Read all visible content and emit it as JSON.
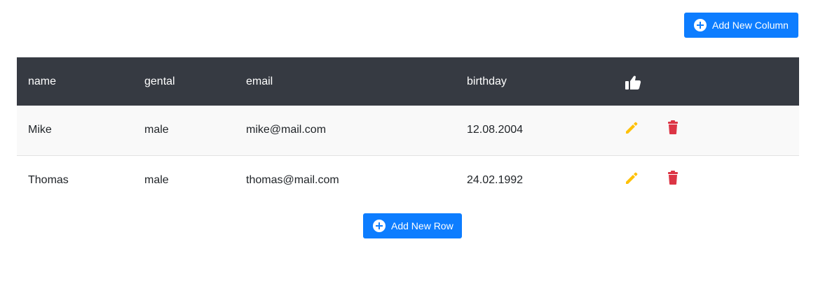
{
  "toolbar": {
    "add_column_label": "Add New Column"
  },
  "table": {
    "headers": [
      "name",
      "gental",
      "email",
      "birthday"
    ],
    "rows": [
      {
        "name": "Mike",
        "gental": "male",
        "email": "mike@mail.com",
        "birthday": "12.08.2004"
      },
      {
        "name": "Thomas",
        "gental": "male",
        "email": "thomas@mail.com",
        "birthday": "24.02.1992"
      }
    ]
  },
  "footer": {
    "add_row_label": "Add New Row"
  },
  "colors": {
    "primary": "#0d7dff",
    "header_bg": "#363a42",
    "edit": "#ffc107",
    "delete": "#dc3545"
  },
  "icons": {
    "header_action": "thumbs-up-icon",
    "edit": "pencil-icon",
    "delete": "trash-icon",
    "add": "plus-circle-icon"
  }
}
